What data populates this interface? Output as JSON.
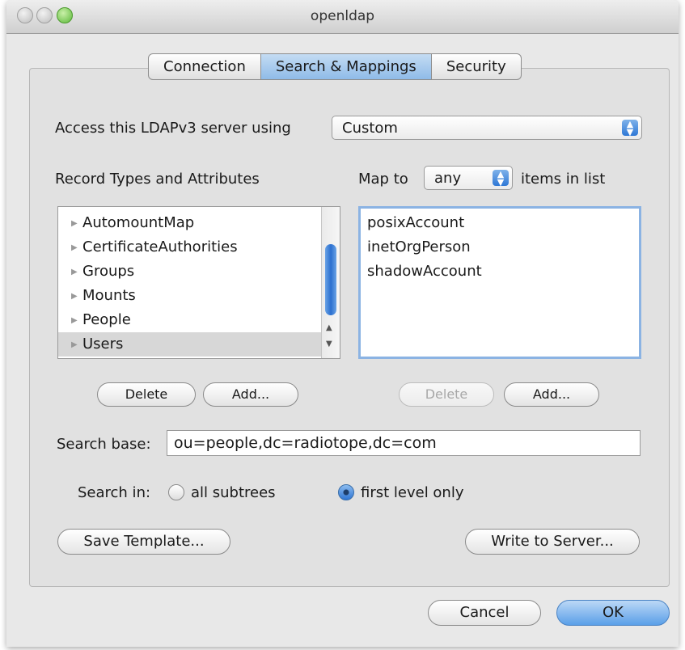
{
  "window": {
    "title": "openldap"
  },
  "tabs": [
    {
      "label": "Connection",
      "active": false
    },
    {
      "label": "Search & Mappings",
      "active": true
    },
    {
      "label": "Security",
      "active": false
    }
  ],
  "access": {
    "label": "Access this LDAPv3 server using",
    "selected": "Custom"
  },
  "record_types": {
    "label": "Record Types and Attributes",
    "items": [
      "AutomountMap",
      "CertificateAuthorities",
      "Groups",
      "Mounts",
      "People",
      "Users"
    ],
    "selected_index": 5,
    "delete_label": "Delete",
    "add_label": "Add..."
  },
  "map": {
    "label_prefix": "Map to",
    "selected": "any",
    "label_suffix": "items in list",
    "items": [
      "posixAccount",
      "inetOrgPerson",
      "shadowAccount"
    ],
    "delete_label": "Delete",
    "add_label": "Add..."
  },
  "search_base": {
    "label": "Search base:",
    "value": "ou=people,dc=radiotope,dc=com"
  },
  "search_in": {
    "label": "Search in:",
    "options": [
      {
        "label": "all subtrees",
        "checked": false
      },
      {
        "label": "first level only",
        "checked": true
      }
    ]
  },
  "buttons": {
    "save_template": "Save Template...",
    "write_to_server": "Write to Server...",
    "cancel": "Cancel",
    "ok": "OK"
  },
  "colors": {
    "accent": "#5a9fe8",
    "selection": "#d7d7d7"
  }
}
